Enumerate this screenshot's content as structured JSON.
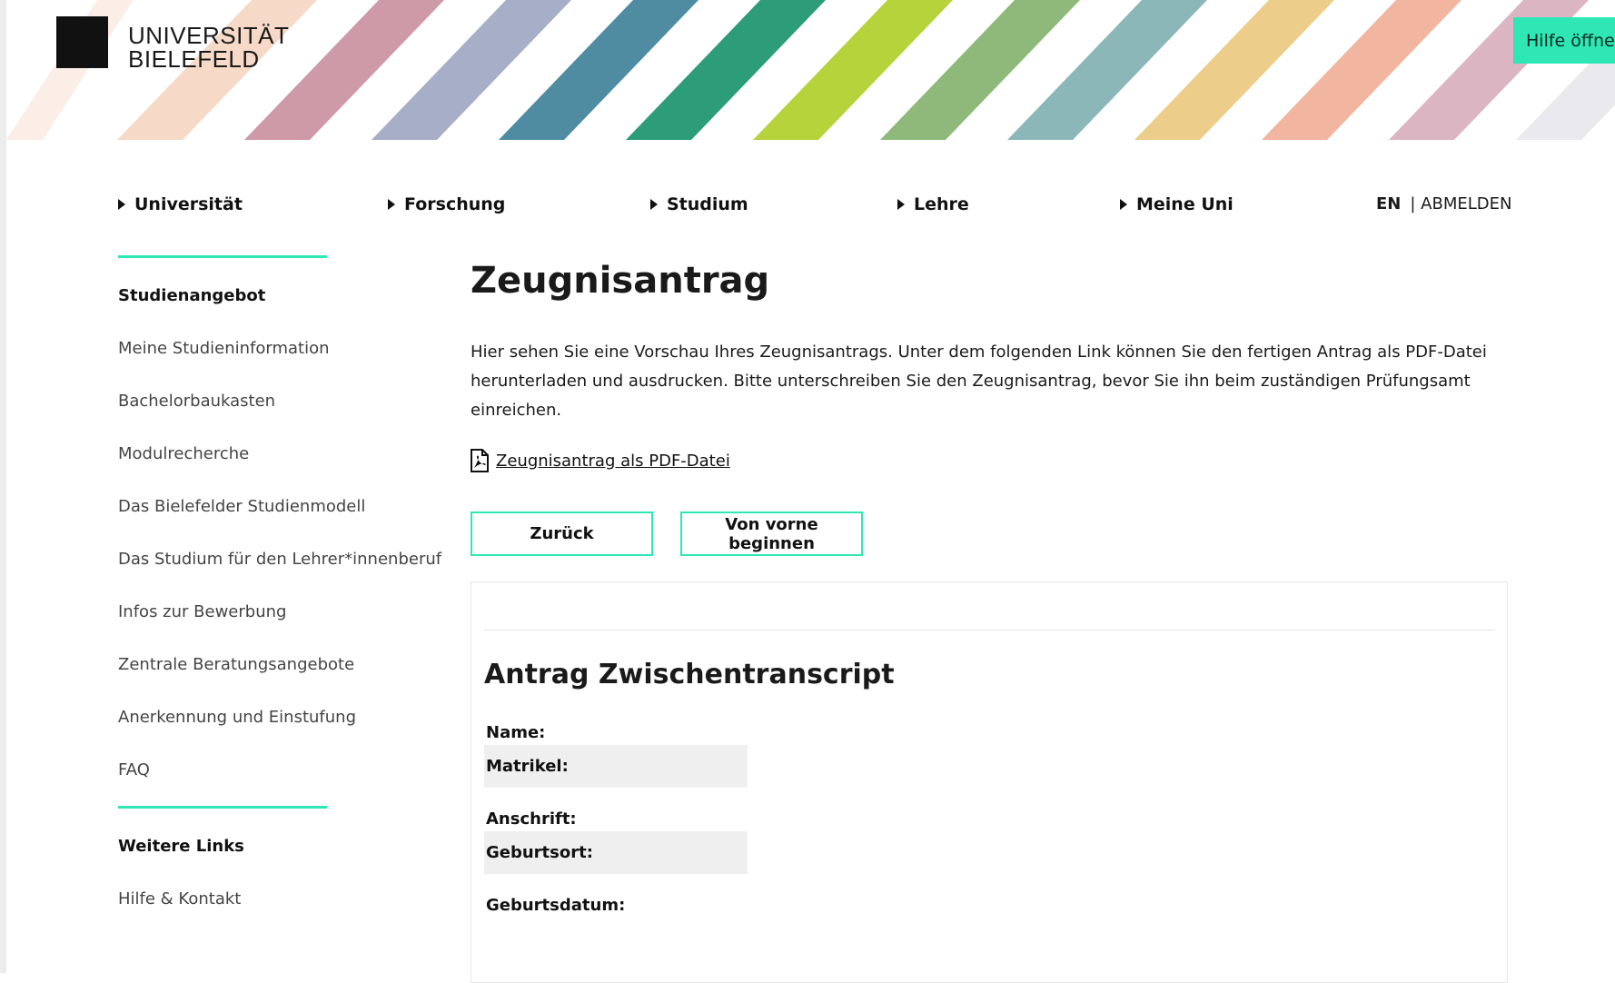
{
  "header": {
    "university_name_line1": "UNIVERSITÄT",
    "university_name_line2": "BIELEFELD",
    "help_button": "Hilfe öffnen",
    "stripe_colors": [
      "#f6d9c7",
      "#cf9aa7",
      "#a7aec7",
      "#4f8ca2",
      "#2d9c78",
      "#b5d33a",
      "#8fb97a",
      "#8bb7b8",
      "#ecce8a",
      "#f2b6a0",
      "#dcb5c2",
      "#e9e9ef"
    ]
  },
  "nav": {
    "items": [
      {
        "label": "Universität"
      },
      {
        "label": "Forschung"
      },
      {
        "label": "Studium"
      },
      {
        "label": "Lehre"
      },
      {
        "label": "Meine Uni"
      }
    ],
    "lang": "EN",
    "logout": "| ABMELDEN"
  },
  "sidebar": {
    "heading1": "Studienangebot",
    "links": [
      "Meine Studieninformation",
      "Bachelorbaukasten",
      "Modulrecherche",
      "Das Bielefelder Studienmodell",
      "Das Studium für den Lehrer*innenberuf",
      "Infos zur Bewerbung",
      "Zentrale Beratungsangebote",
      "Anerkennung und Einstufung",
      "FAQ"
    ],
    "heading2": "Weitere Links",
    "links2": [
      "Hilfe & Kontakt"
    ]
  },
  "content": {
    "title": "Zeugnisantrag",
    "intro": "Hier sehen Sie eine Vorschau Ihres Zeugnisantrags. Unter dem folgenden Link können Sie den fertigen Antrag als PDF-Datei herunterladen und ausdrucken. Bitte unterschreiben Sie den Zeugnisantrag, bevor Sie ihn beim zuständigen Prüfungsamt einreichen.",
    "pdf_link": "Zeugnisantrag als PDF-Datei",
    "back_button": "Zurück",
    "restart_button": "Von vorne beginnen",
    "preview": {
      "title": "Antrag Zwischentranscript",
      "fields": [
        "Name:",
        "Matrikel:",
        "Anschrift:",
        "Geburtsort:",
        "Geburtsdatum:"
      ]
    }
  },
  "accent_color": "#2ee7b5"
}
